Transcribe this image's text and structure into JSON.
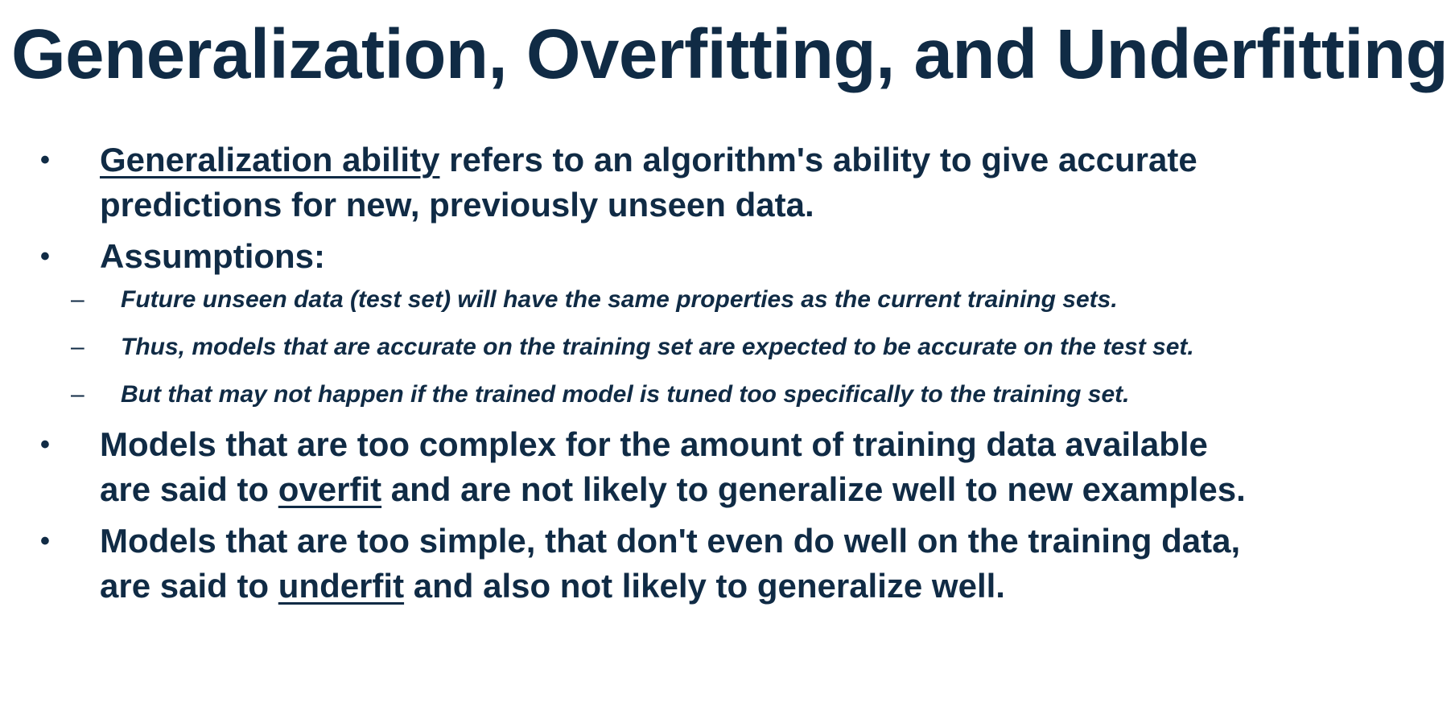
{
  "title": "Generalization, Overfitting, and Underfitting",
  "bullets": [
    {
      "underlined": "Generalization ability",
      "line1_rest": " refers to an algorithm's ability to give accurate",
      "line2": "predictions for new, previously unseen data."
    },
    {
      "text": "Assumptions:",
      "subitems": [
        "Future unseen data (test set) will have the same properties as the current training sets.",
        "Thus, models that are accurate on the training set are expected to be accurate on the test set.",
        "But that may not happen if the trained model is tuned too specifically to the training set."
      ]
    },
    {
      "line1": "Models that are too complex for the amount of training data available",
      "line2_pre": "are said to ",
      "underlined": "overfit",
      "line2_post": " and are not likely to generalize well to new examples."
    },
    {
      "line1": "Models that are too simple, that don't even do well on the training data,",
      "line2_pre": "are said to ",
      "underlined": "underfit",
      "line2_post": " and also not likely to generalize well."
    }
  ],
  "symbols": {
    "bullet": "•",
    "dash": "–"
  },
  "colors": {
    "text": "#102b45",
    "background": "#ffffff"
  }
}
